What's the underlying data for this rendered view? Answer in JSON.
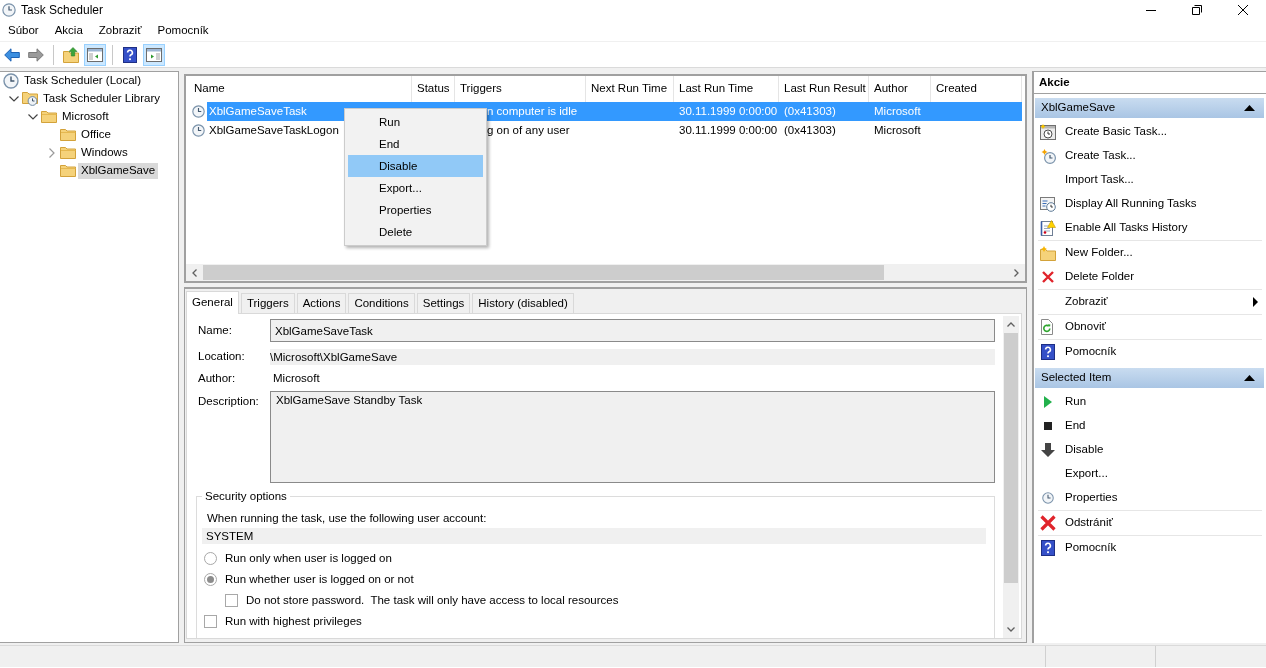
{
  "window": {
    "title": "Task Scheduler"
  },
  "menu_bar": [
    "Súbor",
    "Akcia",
    "Zobraziť",
    "Pomocník"
  ],
  "toolbar": [
    {
      "kind": "back",
      "disabled": false
    },
    {
      "kind": "forward",
      "disabled": true
    },
    {
      "kind": "separator"
    },
    {
      "kind": "up-folder"
    },
    {
      "kind": "tree-toggle",
      "on": true
    },
    {
      "kind": "separator"
    },
    {
      "kind": "help"
    },
    {
      "kind": "pane-toggle",
      "on": true
    }
  ],
  "tree": [
    {
      "label": "Task Scheduler (Local)",
      "kind": "clock",
      "selected": false,
      "children": [
        {
          "label": "Task Scheduler Library",
          "kind": "library",
          "selected": false,
          "expanded": true,
          "children": [
            {
              "label": "Microsoft",
              "kind": "folder",
              "selected": false,
              "expanded": true,
              "children": [
                {
                  "label": "Office",
                  "kind": "folder",
                  "selected": false
                },
                {
                  "label": "Windows",
                  "kind": "folder",
                  "selected": false,
                  "expanded": false
                },
                {
                  "label": "XblGameSave",
                  "kind": "folder",
                  "selected": true
                }
              ]
            }
          ]
        }
      ]
    }
  ],
  "table": {
    "columns": [
      "Name",
      "Status",
      "Triggers",
      "Next Run Time",
      "Last Run Time",
      "Last Run Result",
      "Author",
      "Created"
    ],
    "rows": [
      {
        "name": "XblGameSaveTask",
        "triggers": "n computer is idle",
        "last_run_time": "30.11.1999 0:00:00",
        "last_run_result": "(0x41303)",
        "author": "Microsoft",
        "selected": true
      },
      {
        "name": "XblGameSaveTaskLogon",
        "triggers": "g on of any user",
        "last_run_time": "30.11.1999 0:00:00",
        "last_run_result": "(0x41303)",
        "author": "Microsoft",
        "selected": false
      }
    ]
  },
  "context_menu": {
    "items": [
      {
        "label": "Run",
        "selected": false
      },
      {
        "label": "End",
        "selected": false
      },
      {
        "label": "Disable",
        "selected": true
      },
      {
        "label": "Export...",
        "selected": false
      },
      {
        "label": "Properties",
        "selected": false
      },
      {
        "label": "Delete",
        "selected": false
      }
    ]
  },
  "details": {
    "tabs": [
      {
        "label": "General",
        "selected": true
      },
      {
        "label": "Triggers",
        "selected": false
      },
      {
        "label": "Actions",
        "selected": false
      },
      {
        "label": "Conditions",
        "selected": false
      },
      {
        "label": "Settings",
        "selected": false
      },
      {
        "label": "History (disabled)",
        "selected": false
      }
    ],
    "general": {
      "name": {
        "label": "Name:",
        "value": "XblGameSaveTask"
      },
      "location": {
        "label": "Location:",
        "value": "\\Microsoft\\XblGameSave"
      },
      "author": {
        "label": "Author:",
        "value": "Microsoft"
      },
      "description": {
        "label": "Description:",
        "value": "XblGameSave Standby Task"
      },
      "security": {
        "title": "Security options",
        "account_prompt": "When running the task, use the following user account:",
        "account": "SYSTEM",
        "options": [
          {
            "kind": "radio",
            "label": "Run only when user is logged on",
            "checked": false
          },
          {
            "kind": "radio",
            "label": "Run whether user is logged on or not",
            "checked": true,
            "children": [
              {
                "kind": "checkbox",
                "label": "Do not store password.  The task will only have access to local resources",
                "checked": false
              }
            ]
          },
          {
            "kind": "checkbox",
            "label": "Run with highest privileges",
            "checked": false
          }
        ]
      }
    }
  },
  "actions": {
    "title": "Akcie",
    "sections": [
      {
        "title": "XblGameSave",
        "expanded": true,
        "groups": [
          {
            "items": [
              {
                "label": "Create Basic Task...",
                "kind": "basic-task"
              },
              {
                "label": "Create Task...",
                "kind": "create-task"
              },
              {
                "label": "Import Task...",
                "kind": "plain"
              },
              {
                "label": "Display All Running Tasks",
                "kind": "running-tasks"
              },
              {
                "label": "Enable All Tasks History",
                "kind": "history"
              }
            ]
          },
          {
            "items": [
              {
                "label": "New Folder...",
                "kind": "new-folder"
              },
              {
                "label": "Delete Folder",
                "kind": "delete"
              }
            ]
          },
          {
            "items": [
              {
                "label": "Zobraziť",
                "kind": "plain",
                "submenu": true
              }
            ]
          },
          {
            "items": [
              {
                "label": "Obnoviť",
                "kind": "refresh"
              }
            ]
          },
          {
            "items": [
              {
                "label": "Pomocník",
                "kind": "help"
              }
            ]
          }
        ]
      },
      {
        "title": "Selected Item",
        "expanded": true,
        "groups": [
          {
            "items": [
              {
                "label": "Run",
                "kind": "run"
              },
              {
                "label": "End",
                "kind": "end"
              },
              {
                "label": "Disable",
                "kind": "disable"
              },
              {
                "label": "Export...",
                "kind": "plain"
              },
              {
                "label": "Properties",
                "kind": "properties"
              }
            ]
          },
          {
            "items": [
              {
                "label": "Odstrániť",
                "kind": "delete-large"
              }
            ]
          },
          {
            "items": [
              {
                "label": "Pomocník",
                "kind": "help"
              }
            ]
          }
        ]
      }
    ]
  }
}
